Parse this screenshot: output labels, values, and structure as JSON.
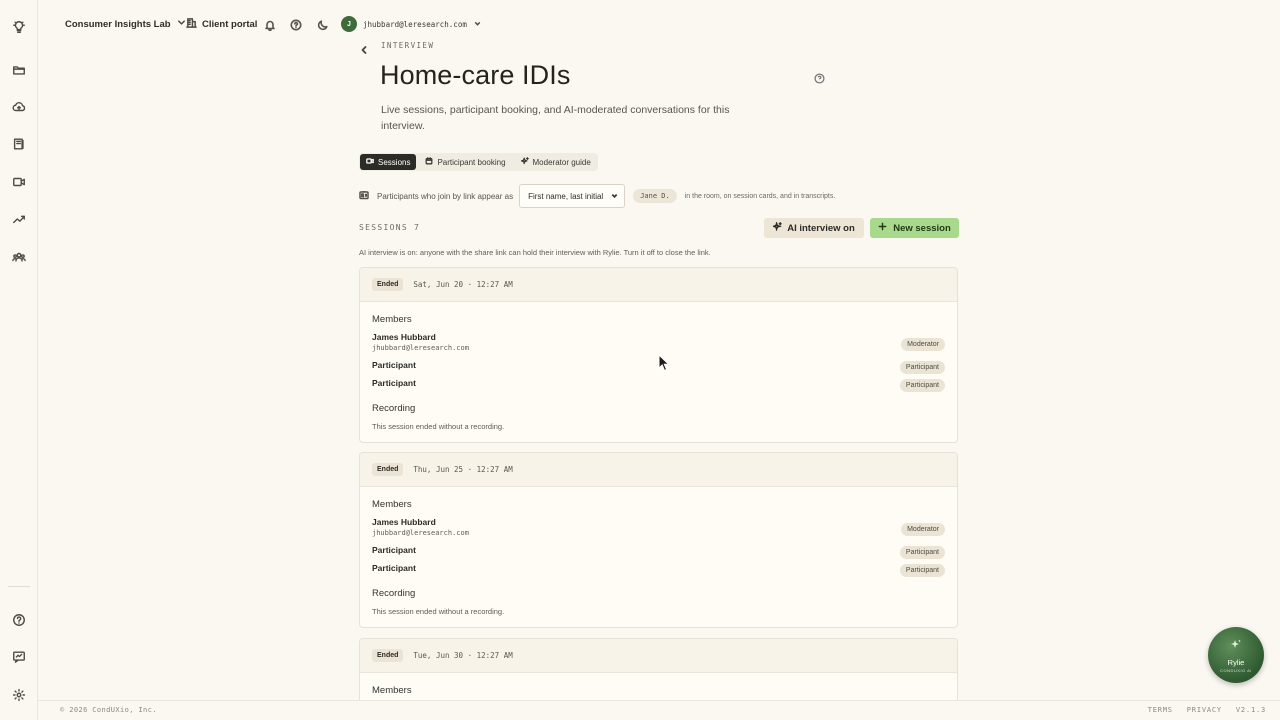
{
  "topbar": {
    "workspace": "Consumer Insights Lab",
    "portal": "Client portal",
    "user_initial": "J",
    "user_email": "jhubbard@leresearch.com"
  },
  "page": {
    "eyebrow": "INTERVIEW",
    "title": "Home-care IDIs",
    "subtitle": "Live sessions, participant booking, and AI-moderated conversations for this interview."
  },
  "tabs": [
    {
      "label": "Sessions",
      "active": true
    },
    {
      "label": "Participant booking",
      "active": false
    },
    {
      "label": "Moderator guide",
      "active": false
    }
  ],
  "name_display": {
    "lead": "Participants who join by link appear as",
    "selected": "First name, last initial",
    "example": "Jane D.",
    "trail": "in the room, on session cards, and in transcripts."
  },
  "sessions": {
    "label": "SESSIONS 7",
    "ai_button": "AI interview on",
    "new_button": "New session",
    "ai_note": "AI interview is on: anyone with the share link can hold their interview with Rylie. Turn it off to close the link.",
    "cards": [
      {
        "status": "Ended",
        "date": "Sat, Jun 20 · 12:27 AM",
        "members_title": "Members",
        "members": [
          {
            "name": "James Hubbard",
            "email": "jhubbard@leresearch.com",
            "role": "Moderator"
          },
          {
            "name": "Participant",
            "role": "Participant"
          },
          {
            "name": "Participant",
            "role": "Participant"
          }
        ],
        "recording_title": "Recording",
        "recording_note": "This session ended without a recording."
      },
      {
        "status": "Ended",
        "date": "Thu, Jun 25 · 12:27 AM",
        "members_title": "Members",
        "members": [
          {
            "name": "James Hubbard",
            "email": "jhubbard@leresearch.com",
            "role": "Moderator"
          },
          {
            "name": "Participant",
            "role": "Participant"
          },
          {
            "name": "Participant",
            "role": "Participant"
          }
        ],
        "recording_title": "Recording",
        "recording_note": "This session ended without a recording."
      },
      {
        "status": "Ended",
        "date": "Tue, Jun 30 · 12:27 AM",
        "members_title": "Members"
      }
    ]
  },
  "footer": {
    "copyright": "© 2026 CondUXio, Inc.",
    "terms": "TERMS",
    "privacy": "PRIVACY",
    "version": "V2.1.3"
  },
  "assistant": {
    "name": "Rylie",
    "tag": "CONDUXIO AI"
  },
  "colors": {
    "background": "#fbf8f2",
    "active_tab": "#2b2b27",
    "new_session_button": "#a8d98c",
    "assistant": "#2f5a31"
  },
  "icons": {
    "rail": [
      "lightbulb-icon",
      "folder-icon",
      "cloud-upload-icon",
      "book-icon",
      "video-icon",
      "trend-chart-icon",
      "users-icon",
      "help-icon",
      "feedback-icon",
      "gear-icon"
    ]
  }
}
